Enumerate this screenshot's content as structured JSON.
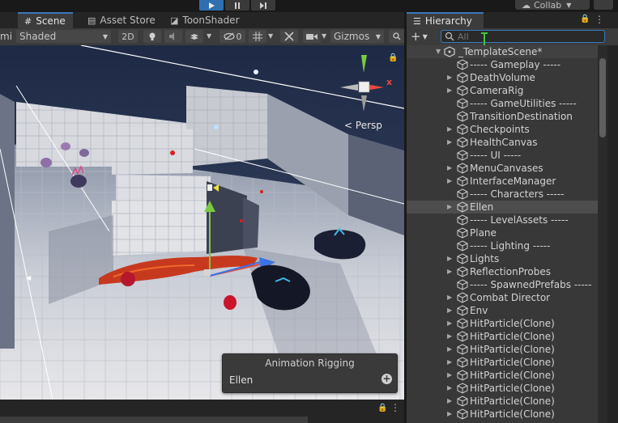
{
  "tabs": [
    "Scene",
    "Asset Store",
    "ToonShader"
  ],
  "collab_label": "Collab",
  "scene_toolbar": {
    "left_cut": "mi",
    "shading_mode": "Shaded",
    "two_d": "2D",
    "hidden_count": "0",
    "gizmos": "Gizmos"
  },
  "viewport": {
    "projection": "Persp",
    "axis_x": "x",
    "axis_y": "y"
  },
  "overlay": {
    "title": "Animation Rigging",
    "item": "Ellen"
  },
  "hierarchy": {
    "title": "Hierarchy",
    "search_placeholder": "All",
    "scene_name": "_TemplateScene*",
    "items": [
      {
        "label": "----- Gameplay -----",
        "fold": false
      },
      {
        "label": "DeathVolume",
        "fold": true
      },
      {
        "label": "CameraRig",
        "fold": true
      },
      {
        "label": "----- GameUtilities -----",
        "fold": false
      },
      {
        "label": "TransitionDestination",
        "fold": false
      },
      {
        "label": "Checkpoints",
        "fold": true
      },
      {
        "label": "HealthCanvas",
        "fold": true
      },
      {
        "label": "----- UI -----",
        "fold": false
      },
      {
        "label": "MenuCanvases",
        "fold": true
      },
      {
        "label": "InterfaceManager",
        "fold": true
      },
      {
        "label": "----- Characters -----",
        "fold": false
      },
      {
        "label": "Ellen",
        "fold": true,
        "selected": true
      },
      {
        "label": "----- LevelAssets -----",
        "fold": false
      },
      {
        "label": "Plane",
        "fold": false
      },
      {
        "label": "----- Lighting -----",
        "fold": false
      },
      {
        "label": "Lights",
        "fold": true
      },
      {
        "label": "ReflectionProbes",
        "fold": true
      },
      {
        "label": "----- SpawnedPrefabs -----",
        "fold": false
      },
      {
        "label": "Combat Director",
        "fold": true
      },
      {
        "label": "Env",
        "fold": true
      },
      {
        "label": "HitParticle(Clone)",
        "fold": true
      },
      {
        "label": "HitParticle(Clone)",
        "fold": true
      },
      {
        "label": "HitParticle(Clone)",
        "fold": true
      },
      {
        "label": "HitParticle(Clone)",
        "fold": true
      },
      {
        "label": "HitParticle(Clone)",
        "fold": true
      },
      {
        "label": "HitParticle(Clone)",
        "fold": true
      },
      {
        "label": "HitParticle(Clone)",
        "fold": true
      },
      {
        "label": "HitParticle(Clone)",
        "fold": true
      }
    ]
  },
  "colors": {
    "accent": "#3a79bb",
    "play_active": "#2f6fb0",
    "panel": "#383838",
    "selection": "#4d4d4d"
  }
}
